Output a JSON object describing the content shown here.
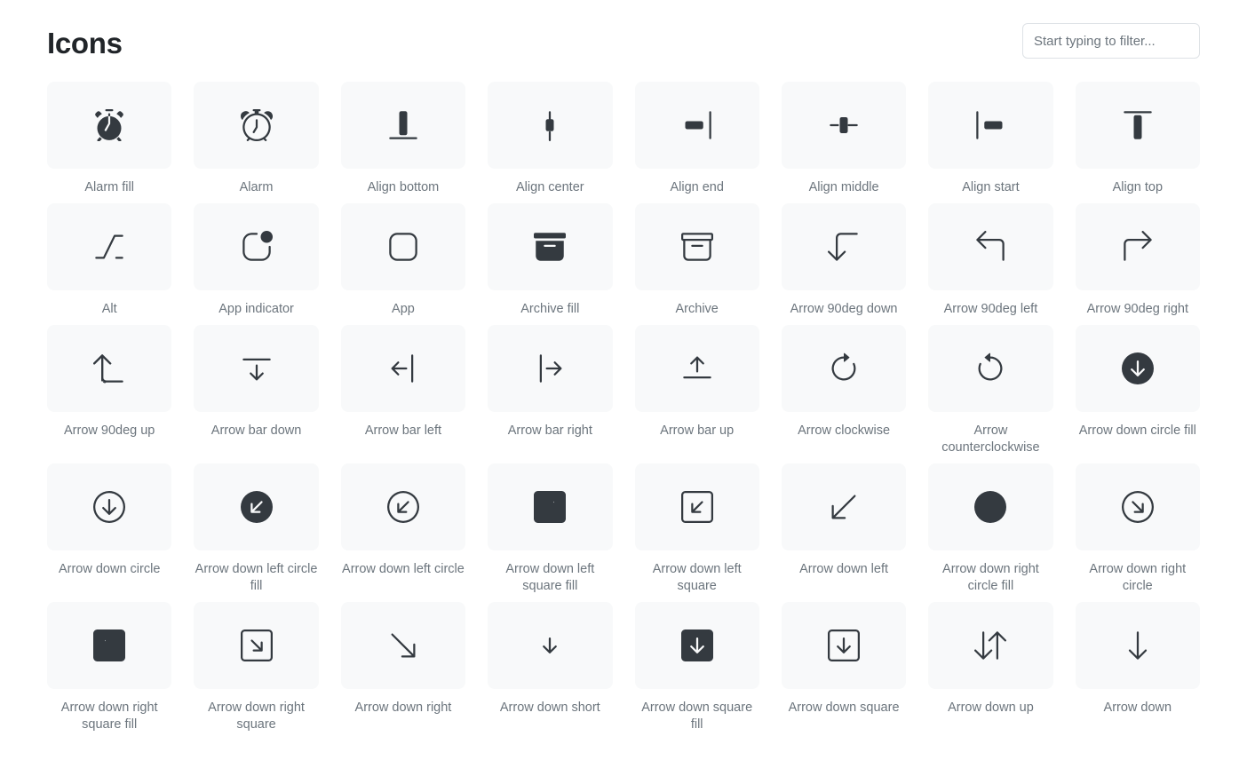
{
  "header": {
    "title": "Icons",
    "filter_placeholder": "Start typing to filter...",
    "filter_value": ""
  },
  "colors": {
    "page_background": "#ffffff",
    "tile_background": "#f8f9fa",
    "icon_color": "#343a40",
    "title_color": "#212529",
    "label_color": "#6c757d",
    "input_border": "#dee2e6"
  },
  "icons": [
    {
      "name": "Alarm fill",
      "icon": "alarm-fill-icon"
    },
    {
      "name": "Alarm",
      "icon": "alarm-icon"
    },
    {
      "name": "Align bottom",
      "icon": "align-bottom-icon"
    },
    {
      "name": "Align center",
      "icon": "align-center-icon"
    },
    {
      "name": "Align end",
      "icon": "align-end-icon"
    },
    {
      "name": "Align middle",
      "icon": "align-middle-icon"
    },
    {
      "name": "Align start",
      "icon": "align-start-icon"
    },
    {
      "name": "Align top",
      "icon": "align-top-icon"
    },
    {
      "name": "Alt",
      "icon": "alt-icon"
    },
    {
      "name": "App indicator",
      "icon": "app-indicator-icon"
    },
    {
      "name": "App",
      "icon": "app-icon"
    },
    {
      "name": "Archive fill",
      "icon": "archive-fill-icon"
    },
    {
      "name": "Archive",
      "icon": "archive-icon"
    },
    {
      "name": "Arrow 90deg down",
      "icon": "arrow-90deg-down-icon"
    },
    {
      "name": "Arrow 90deg left",
      "icon": "arrow-90deg-left-icon"
    },
    {
      "name": "Arrow 90deg right",
      "icon": "arrow-90deg-right-icon"
    },
    {
      "name": "Arrow 90deg up",
      "icon": "arrow-90deg-up-icon"
    },
    {
      "name": "Arrow bar down",
      "icon": "arrow-bar-down-icon"
    },
    {
      "name": "Arrow bar left",
      "icon": "arrow-bar-left-icon"
    },
    {
      "name": "Arrow bar right",
      "icon": "arrow-bar-right-icon"
    },
    {
      "name": "Arrow bar up",
      "icon": "arrow-bar-up-icon"
    },
    {
      "name": "Arrow clockwise",
      "icon": "arrow-clockwise-icon"
    },
    {
      "name": "Arrow counterclockwise",
      "icon": "arrow-counterclockwise-icon"
    },
    {
      "name": "Arrow down circle fill",
      "icon": "arrow-down-circle-fill-icon"
    },
    {
      "name": "Arrow down circle",
      "icon": "arrow-down-circle-icon"
    },
    {
      "name": "Arrow down left circle fill",
      "icon": "arrow-down-left-circle-fill-icon"
    },
    {
      "name": "Arrow down left circle",
      "icon": "arrow-down-left-circle-icon"
    },
    {
      "name": "Arrow down left square fill",
      "icon": "arrow-down-left-square-fill-icon"
    },
    {
      "name": "Arrow down left square",
      "icon": "arrow-down-left-square-icon"
    },
    {
      "name": "Arrow down left",
      "icon": "arrow-down-left-icon"
    },
    {
      "name": "Arrow down right circle fill",
      "icon": "arrow-down-right-circle-fill-icon"
    },
    {
      "name": "Arrow down right circle",
      "icon": "arrow-down-right-circle-icon"
    },
    {
      "name": "Arrow down right square fill",
      "icon": "arrow-down-right-square-fill-icon"
    },
    {
      "name": "Arrow down right square",
      "icon": "arrow-down-right-square-icon"
    },
    {
      "name": "Arrow down right",
      "icon": "arrow-down-right-icon"
    },
    {
      "name": "Arrow down short",
      "icon": "arrow-down-short-icon"
    },
    {
      "name": "Arrow down square fill",
      "icon": "arrow-down-square-fill-icon"
    },
    {
      "name": "Arrow down square",
      "icon": "arrow-down-square-icon"
    },
    {
      "name": "Arrow down up",
      "icon": "arrow-down-up-icon"
    },
    {
      "name": "Arrow down",
      "icon": "arrow-down-icon"
    }
  ]
}
